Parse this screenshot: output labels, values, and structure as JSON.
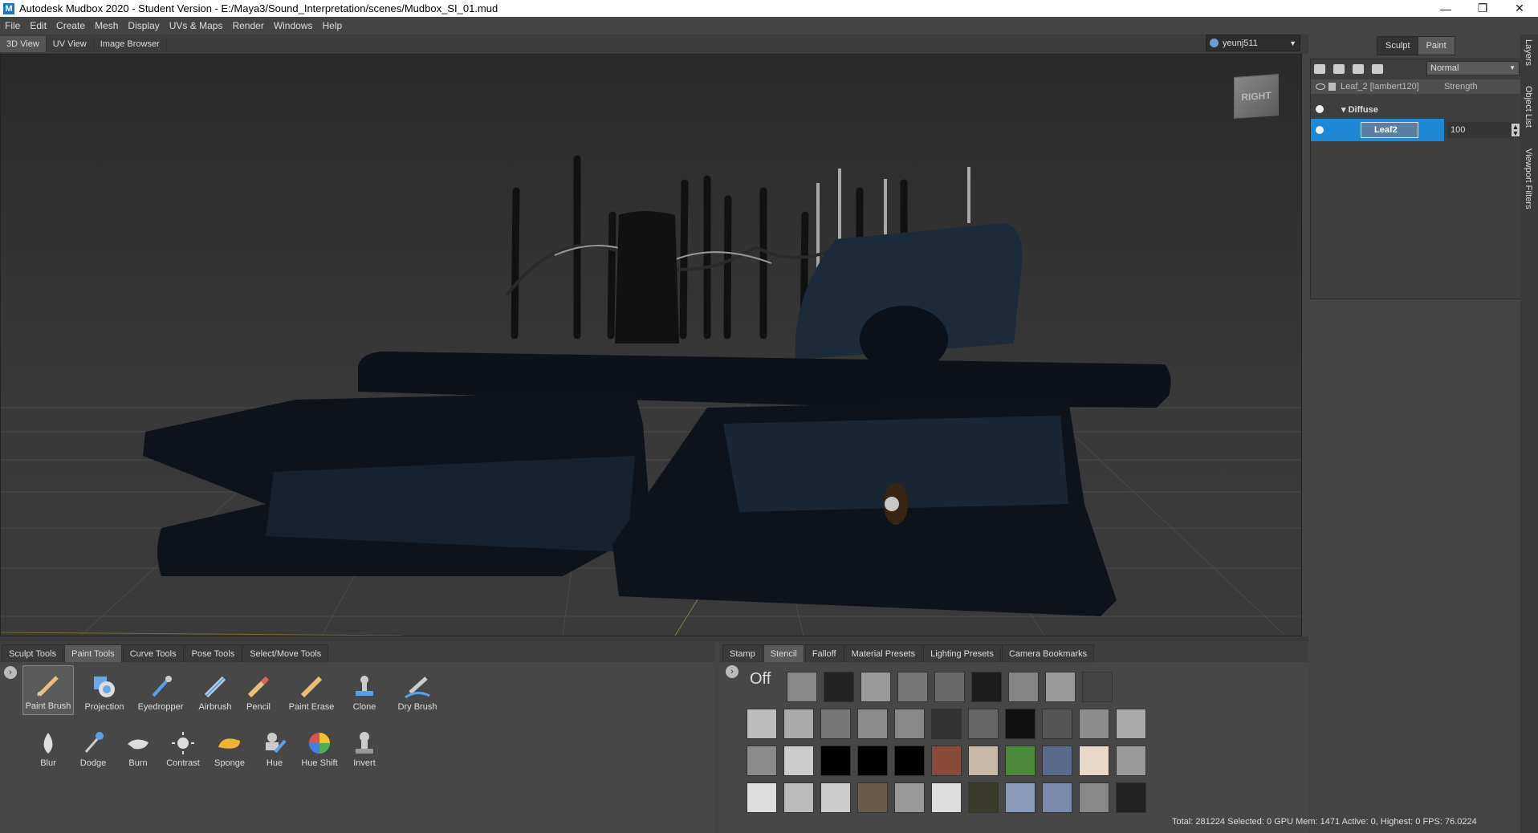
{
  "window": {
    "title": "Autodesk Mudbox 2020 - Student Version - E:/Maya3/Sound_Interpretation/scenes/Mudbox_SI_01.mud",
    "logo": "M",
    "controls": [
      "—",
      "❐",
      "✕"
    ]
  },
  "menu": [
    "File",
    "Edit",
    "Create",
    "Mesh",
    "Display",
    "UVs & Maps",
    "Render",
    "Windows",
    "Help"
  ],
  "view_tabs": [
    "3D View",
    "UV View",
    "Image Browser"
  ],
  "user": {
    "name": "yeunj511"
  },
  "viewcube": {
    "label": "RIGHT"
  },
  "sculpt_paint": {
    "sculpt": "Sculpt",
    "paint": "Paint",
    "active": "Paint"
  },
  "layers": {
    "blend_mode": "Normal",
    "layer_name": "Leaf_2 [lambert120]",
    "strength_label": "Strength",
    "channel": "Diffuse",
    "paint_layer": "Leaf2",
    "paint_layer_value": "100"
  },
  "side_tabs": [
    "Layers",
    "Object List",
    "Viewport Filters"
  ],
  "tool_tabs": [
    "Sculpt Tools",
    "Paint Tools",
    "Curve Tools",
    "Pose Tools",
    "Select/Move Tools"
  ],
  "tool_tabs_active": "Paint Tools",
  "paint_tools_row1": [
    "Paint Brush",
    "Projection",
    "Eyedropper",
    "Airbrush",
    "Pencil",
    "Paint Erase",
    "Clone",
    "Dry Brush"
  ],
  "paint_tools_row2": [
    "Blur",
    "Dodge",
    "Burn",
    "Contrast",
    "Sponge",
    "Hue",
    "Hue Shift",
    "Invert"
  ],
  "stencil_tabs": [
    "Stamp",
    "Stencil",
    "Falloff",
    "Material Presets",
    "Lighting Presets",
    "Camera Bookmarks"
  ],
  "stencil_tabs_active": "Stencil",
  "stencil_off": "Off",
  "status": "Total: 281224  Selected: 0 GPU Mem: 1471  Active: 0, Highest: 0  FPS: 76.0224",
  "colors": {
    "accent": "#1e88d6",
    "bg": "#444444"
  }
}
